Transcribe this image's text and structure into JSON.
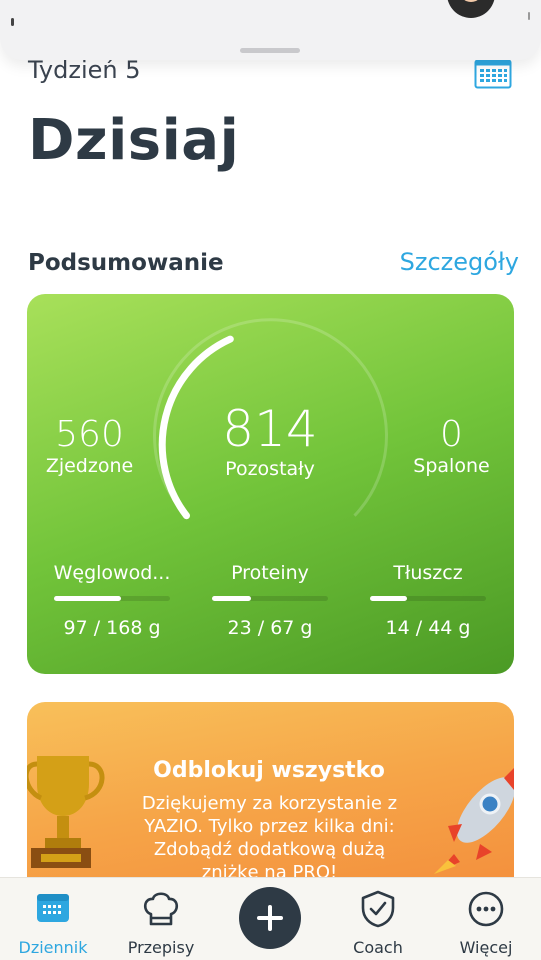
{
  "header": {
    "week_label": "Tydzień 5",
    "title": "Dzisiaj"
  },
  "summary": {
    "section_title": "Podsumowanie",
    "details_link": "Szczegóły",
    "eaten_value": "560",
    "eaten_label": "Zjedzone",
    "remaining_value": "814",
    "remaining_label": "Pozostały",
    "burned_value": "0",
    "burned_label": "Spalone",
    "macros": [
      {
        "name": "Węglowod...",
        "value": "97 / 168 g",
        "progress": 0.58
      },
      {
        "name": "Proteiny",
        "value": "23 / 67 g",
        "progress": 0.34
      },
      {
        "name": "Tłuszcz",
        "value": "14 / 44 g",
        "progress": 0.32
      }
    ],
    "colors": {
      "card_start": "#a8e05a",
      "card_end": "#4b9a25"
    }
  },
  "promo": {
    "title": "Odblokuj wszystko",
    "text": "Dziękujemy za korzystanie z YAZIO. Tylko przez kilka dni: Zdobądź dodatkową dużą zniżkę na PRO!"
  },
  "nav": {
    "items": [
      {
        "label": "Dziennik",
        "icon": "calendar-icon",
        "active": true
      },
      {
        "label": "Przepisy",
        "icon": "chef-hat-icon",
        "active": false
      },
      {
        "label": "Coach",
        "icon": "shield-check-icon",
        "active": false
      },
      {
        "label": "Więcej",
        "icon": "more-icon",
        "active": false
      }
    ],
    "fab_icon": "plus-icon"
  },
  "accent_color": "#2ea7e0"
}
